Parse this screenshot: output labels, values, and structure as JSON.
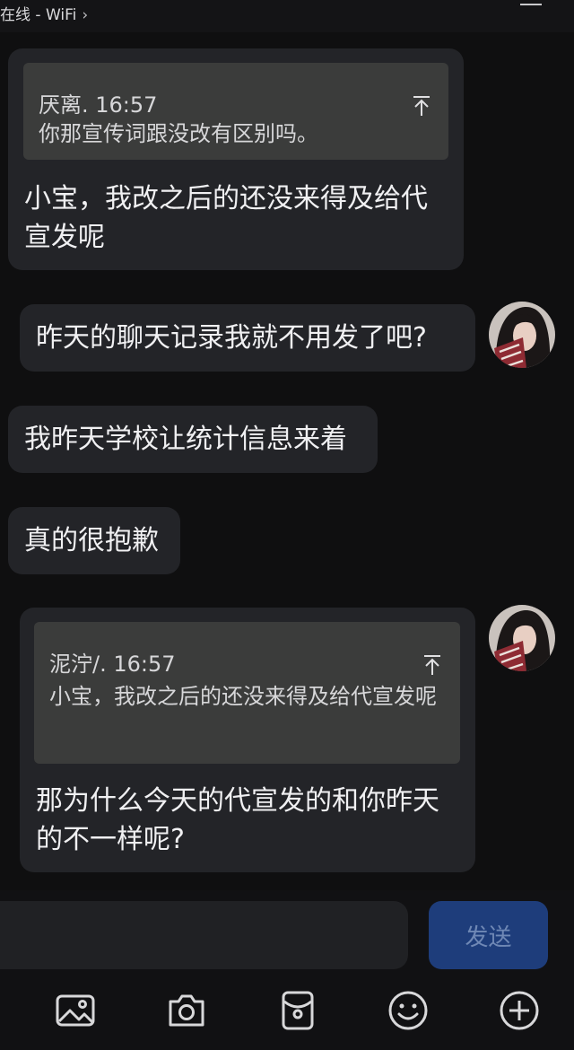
{
  "status": {
    "text": "在线 - WiFi",
    "chevron": "›"
  },
  "messages": [
    {
      "side": "left",
      "quote": {
        "author_time": "厌离. 16:57",
        "text": "你那宣传词跟没改有区别吗。"
      },
      "text": "小宝，我改之后的还没来得及给代宣发呢"
    },
    {
      "side": "right",
      "text": "昨天的聊天记录我就不用发了吧?"
    },
    {
      "side": "left",
      "text": "我昨天学校让统计信息来着"
    },
    {
      "side": "left",
      "text": "真的很抱歉"
    },
    {
      "side": "right",
      "quote": {
        "author_time": "泥泞/. 16:57",
        "text": "小宝，我改之后的还没来得及给代宣发呢"
      },
      "text": "那为什么今天的代宣发的和你昨天的不一样呢?"
    }
  ],
  "composer": {
    "send_label": "发送",
    "tools": [
      "image-icon",
      "camera-icon",
      "red-packet-icon",
      "emoji-icon",
      "plus-icon"
    ]
  },
  "colors": {
    "send_bg": "#1e3d7b",
    "bubble_bg": "#232428",
    "quote_bg": "#3b3c3b"
  }
}
